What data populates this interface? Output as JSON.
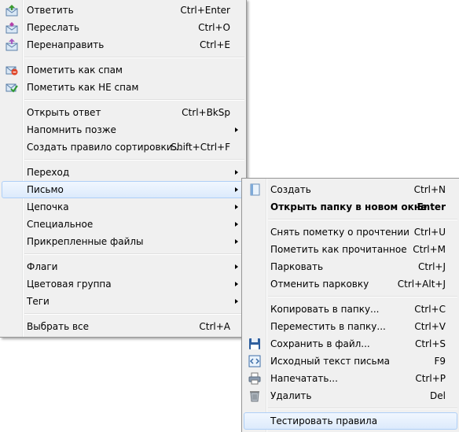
{
  "main_menu": {
    "items": [
      {
        "label": "Ответить",
        "shortcut": "Ctrl+Enter",
        "icon": "reply-icon"
      },
      {
        "label": "Переслать",
        "shortcut": "Ctrl+O",
        "icon": "forward-icon"
      },
      {
        "label": "Перенаправить",
        "shortcut": "Ctrl+E",
        "icon": "redirect-icon"
      },
      {
        "label": "Пометить как спам",
        "shortcut": "",
        "icon": "spam-icon"
      },
      {
        "label": "Пометить как НЕ спам",
        "shortcut": "",
        "icon": "not-spam-icon"
      },
      {
        "label": "Открыть ответ",
        "shortcut": "Ctrl+BkSp"
      },
      {
        "label": "Напомнить позже",
        "shortcut": "",
        "submenu": true
      },
      {
        "label": "Создать правило сортировки...",
        "shortcut": "Shift+Ctrl+F"
      },
      {
        "label": "Переход",
        "shortcut": "",
        "submenu": true
      },
      {
        "label": "Письмо",
        "shortcut": "",
        "submenu": true,
        "highlighted": true
      },
      {
        "label": "Цепочка",
        "shortcut": "",
        "submenu": true
      },
      {
        "label": "Специальное",
        "shortcut": "",
        "submenu": true
      },
      {
        "label": "Прикрепленные файлы",
        "shortcut": "",
        "submenu": true
      },
      {
        "label": "Флаги",
        "shortcut": "",
        "submenu": true
      },
      {
        "label": "Цветовая группа",
        "shortcut": "",
        "submenu": true
      },
      {
        "label": "Теги",
        "shortcut": "",
        "submenu": true
      },
      {
        "label": "Выбрать все",
        "shortcut": "Ctrl+A"
      }
    ]
  },
  "sub_menu": {
    "items": [
      {
        "label": "Создать",
        "shortcut": "Ctrl+N",
        "icon": "new-message-icon"
      },
      {
        "label": "Открыть папку в новом окне",
        "shortcut": "Enter",
        "bold": true
      },
      {
        "label": "Снять пометку о прочтении",
        "shortcut": "Ctrl+U"
      },
      {
        "label": "Пометить как прочитанное",
        "shortcut": "Ctrl+M"
      },
      {
        "label": "Парковать",
        "shortcut": "Ctrl+J"
      },
      {
        "label": "Отменить парковку",
        "shortcut": "Ctrl+Alt+J"
      },
      {
        "label": "Копировать в папку...",
        "shortcut": "Ctrl+C"
      },
      {
        "label": "Переместить в папку...",
        "shortcut": "Ctrl+V"
      },
      {
        "label": "Сохранить в файл...",
        "shortcut": "Ctrl+S",
        "icon": "save-icon"
      },
      {
        "label": "Исходный текст письма",
        "shortcut": "F9",
        "icon": "source-code-icon"
      },
      {
        "label": "Напечатать...",
        "shortcut": "Ctrl+P",
        "icon": "print-icon"
      },
      {
        "label": "Удалить",
        "shortcut": "Del",
        "icon": "trash-icon"
      },
      {
        "label": "Тестировать правила",
        "shortcut": "",
        "highlighted": true
      }
    ]
  },
  "colors": {
    "menu_bg": "#f0f0f0",
    "border": "#979797",
    "highlight_bg": "#dceafc",
    "highlight_border": "#aecff7"
  }
}
